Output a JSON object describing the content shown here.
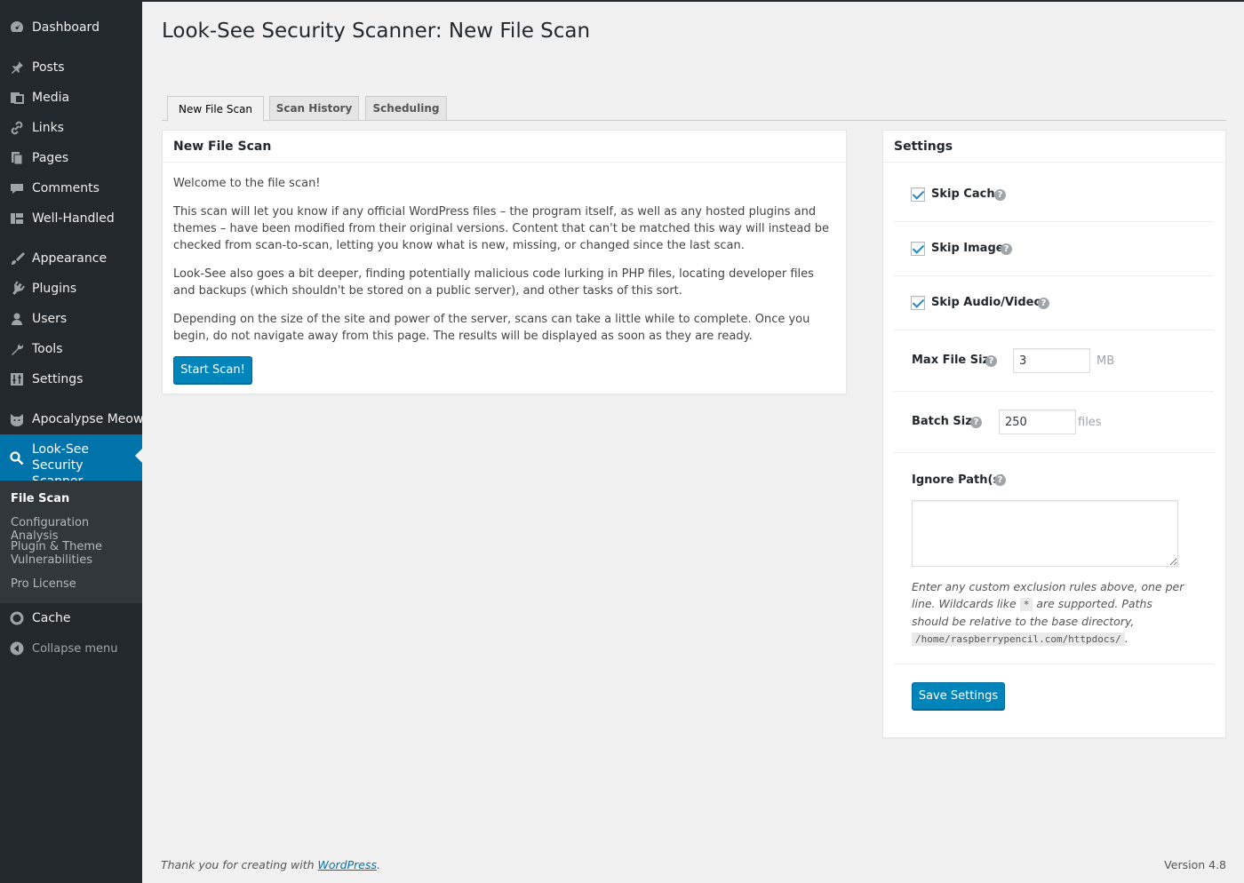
{
  "sidebar": {
    "items": [
      {
        "label": "Dashboard",
        "icon": "dashboard-icon"
      },
      {
        "label": "Posts",
        "icon": "pin-icon"
      },
      {
        "label": "Media",
        "icon": "media-icon"
      },
      {
        "label": "Links",
        "icon": "link-icon"
      },
      {
        "label": "Pages",
        "icon": "pages-icon"
      },
      {
        "label": "Comments",
        "icon": "comment-icon"
      },
      {
        "label": "Well-Handled",
        "icon": "grid-icon"
      },
      {
        "label": "Appearance",
        "icon": "brush-icon"
      },
      {
        "label": "Plugins",
        "icon": "plugin-icon"
      },
      {
        "label": "Users",
        "icon": "user-icon"
      },
      {
        "label": "Tools",
        "icon": "wrench-icon"
      },
      {
        "label": "Settings",
        "icon": "sliders-icon"
      },
      {
        "label": "Apocalypse Meow",
        "icon": "cat-icon"
      },
      {
        "label": "Look-See Security Scanner",
        "icon": "search-icon"
      },
      {
        "label": "Cache",
        "icon": "circle-icon"
      }
    ],
    "submenu": [
      "File Scan",
      "Configuration Analysis",
      "Plugin & Theme Vulnerabilities",
      "Pro License"
    ],
    "collapse_label": "Collapse menu"
  },
  "page": {
    "title": "Look-See Security Scanner: New File Scan"
  },
  "tabs": [
    "New File Scan",
    "Scan History",
    "Scheduling"
  ],
  "scan": {
    "heading": "New File Scan",
    "p1": "Welcome to the file scan!",
    "p2": "This scan will let you know if any official WordPress files – the program itself, as well as any hosted plugins and themes – have been modified from their original versions. Content that can't be matched this way will instead be checked from scan-to-scan, letting you know what is new, missing, or changed since the last scan.",
    "p3": "Look-See also goes a bit deeper, finding potentially malicious code lurking in PHP files, locating developer files and backups (which shouldn't be stored on a public server), and other tasks of this sort.",
    "p4": "Depending on the size of the site and power of the server, scans can take a little while to complete. Once you begin, do not navigate away from this page. The results will be displayed as soon as they are ready.",
    "button": "Start Scan!"
  },
  "settings": {
    "heading": "Settings",
    "skip_cache": "Skip Cache",
    "skip_images": "Skip Images",
    "skip_av": "Skip Audio/Video",
    "max_file_size_label": "Max File Size",
    "max_file_size_value": "3",
    "max_file_size_unit": "MB",
    "batch_size_label": "Batch Size",
    "batch_size_value": "250",
    "batch_size_unit": "files",
    "ignore_label": "Ignore Path(s)",
    "ignore_help_1": "Enter any custom exclusion rules above, one per line. Wildcards like",
    "ignore_wildcard": "*",
    "ignore_help_2": "are supported. Paths should be relative to the base directory,",
    "ignore_base": "/home/raspberrypencil.com/httpdocs/",
    "ignore_help_3": ".",
    "save": "Save Settings",
    "help_glyph": "?"
  },
  "footer": {
    "thanks_prefix": "Thank you for creating with",
    "wp_link": "WordPress",
    "thanks_suffix": ".",
    "version": "Version 4.8"
  }
}
